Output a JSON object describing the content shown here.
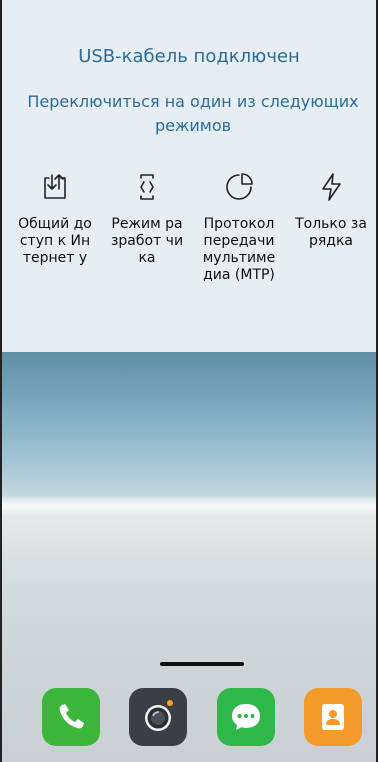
{
  "dialog": {
    "title": "USB-кабель подключен",
    "subtitle": "Переключиться на один из следующих режимов",
    "modes": [
      {
        "label": "Общий доступ к Интернет у",
        "icon": "usb-share-icon"
      },
      {
        "label": "Режим разработ чика",
        "icon": "developer-icon"
      },
      {
        "label": "Протокол передачи мультиме диа (MTP)",
        "icon": "mtp-icon"
      },
      {
        "label": "Только зарядка",
        "icon": "charging-icon"
      }
    ]
  },
  "dock": {
    "apps": [
      {
        "icon": "phone-icon",
        "color": "#3cb53b"
      },
      {
        "icon": "camera-icon",
        "color": "#3b3f45"
      },
      {
        "icon": "messages-icon",
        "color": "#2fb84a"
      },
      {
        "icon": "contacts-icon",
        "color": "#f59b2c"
      }
    ]
  }
}
